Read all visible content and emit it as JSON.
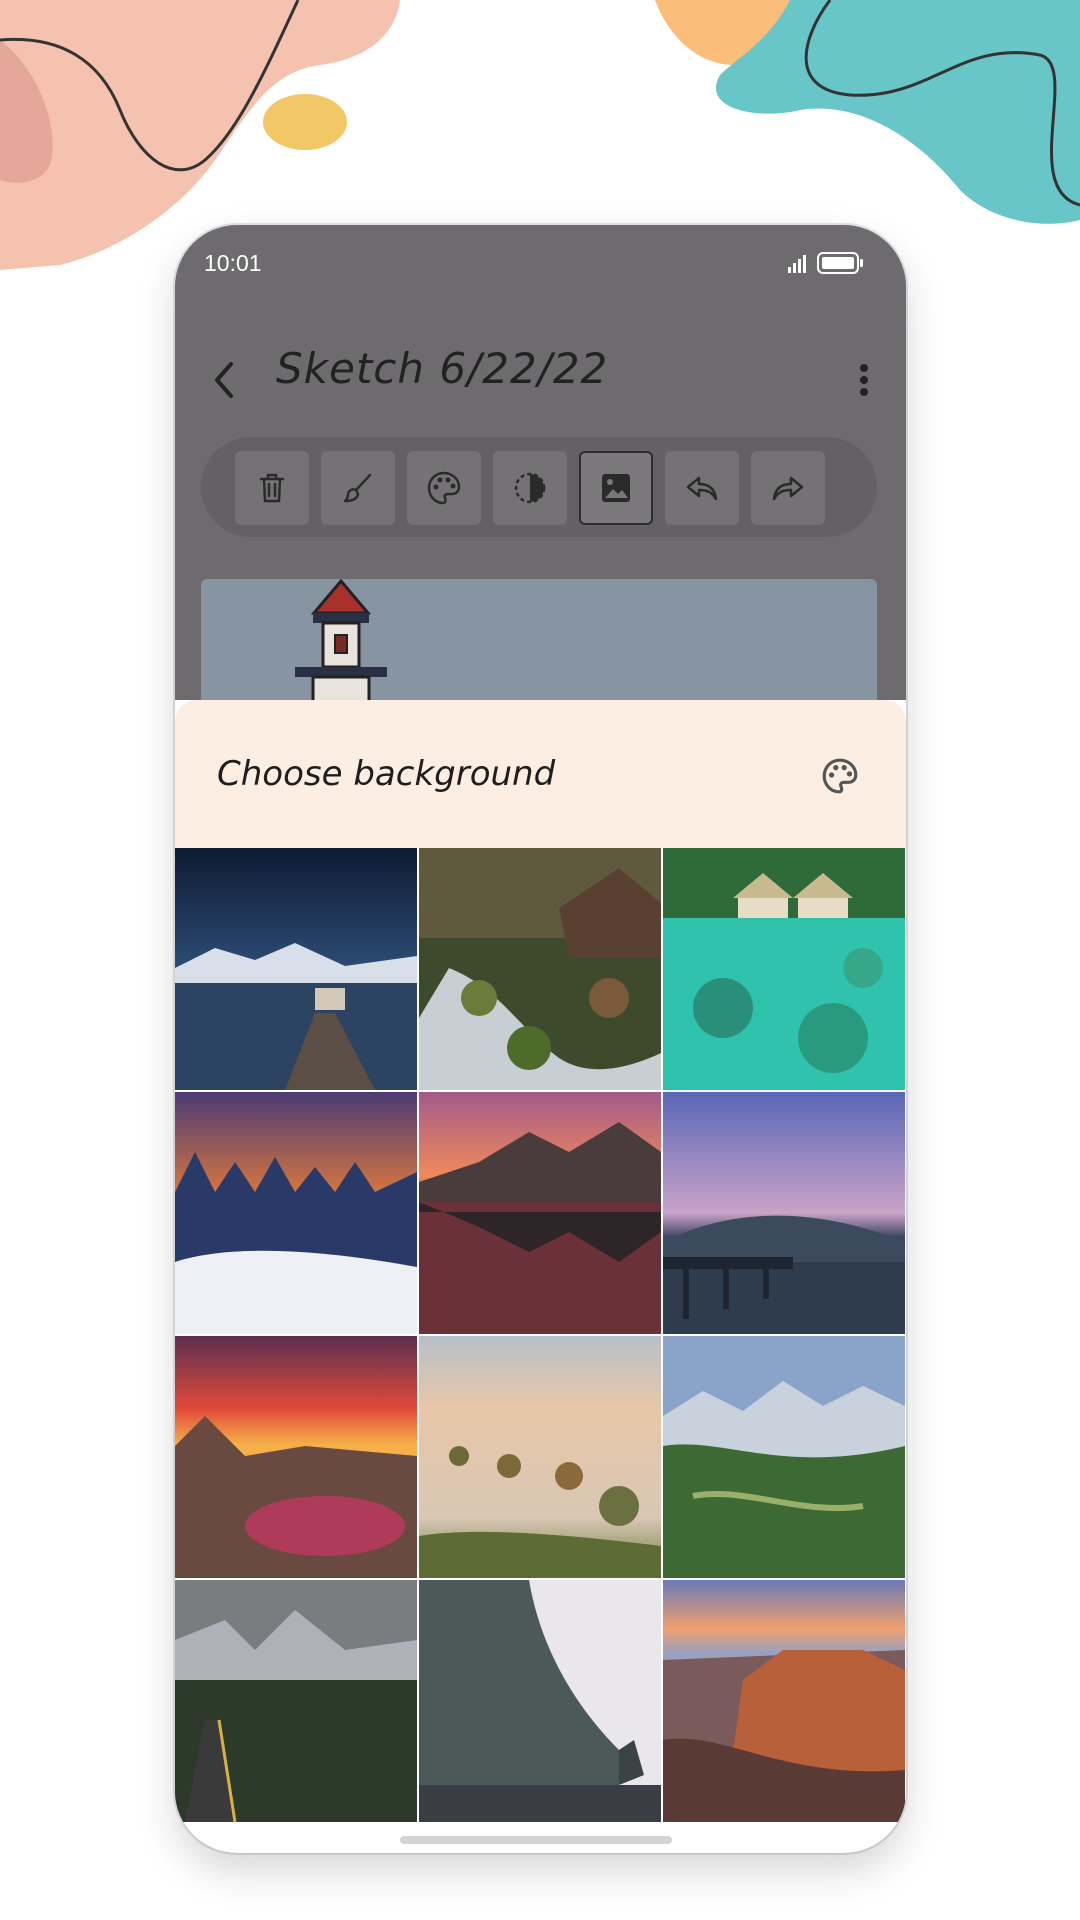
{
  "status_bar": {
    "time": "10:01"
  },
  "app_bar": {
    "title": "Sketch 6/22/22"
  },
  "toolbar": {
    "tools": [
      {
        "icon": "trash-icon",
        "selected": false
      },
      {
        "icon": "brush-icon",
        "selected": false
      },
      {
        "icon": "palette-icon",
        "selected": false
      },
      {
        "icon": "contrast-icon",
        "selected": false
      },
      {
        "icon": "image-icon",
        "selected": true
      },
      {
        "icon": "undo-icon",
        "selected": false
      },
      {
        "icon": "redo-icon",
        "selected": false
      }
    ]
  },
  "sheet": {
    "title": "Choose background",
    "action_icon": "palette-icon",
    "backgrounds": [
      {
        "scene": "starry-lake-pier"
      },
      {
        "scene": "forest-stream-cabin"
      },
      {
        "scene": "tropical-lagoon-huts"
      },
      {
        "scene": "snowy-forest-sunset"
      },
      {
        "scene": "mountain-lake-reflection"
      },
      {
        "scene": "pier-twilight-sea"
      },
      {
        "scene": "red-sky-mountain-lake"
      },
      {
        "scene": "foggy-valley-dawn"
      },
      {
        "scene": "alpine-green-valley"
      },
      {
        "scene": "mountain-road-forest"
      },
      {
        "scene": "basalt-cliff-coast"
      },
      {
        "scene": "canyon-sunset"
      }
    ]
  },
  "colors": {
    "overlay": "#6d6b6e",
    "sheet_header": "#fdeee3",
    "accent_teal": "#68c6c8",
    "accent_peach": "#f4c2ae"
  }
}
